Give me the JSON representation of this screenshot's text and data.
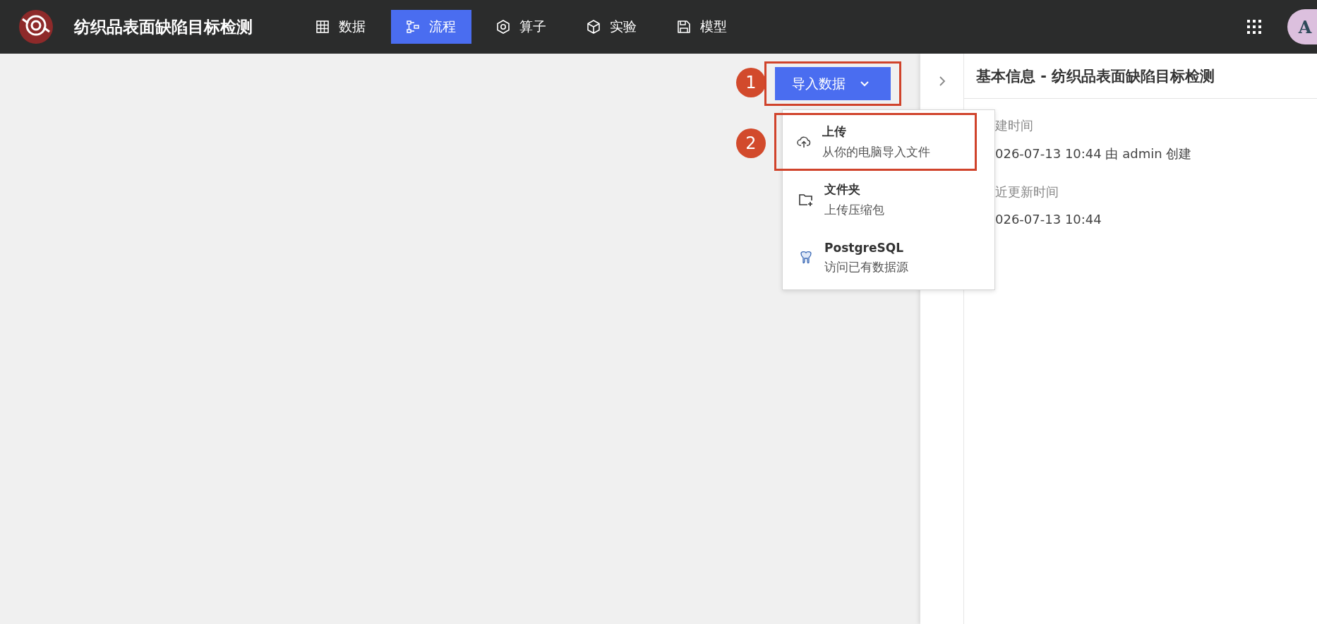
{
  "app": {
    "title": "纺织品表面缺陷目标检测"
  },
  "nav": [
    {
      "label": "数据",
      "kind": "table",
      "selected": false
    },
    {
      "label": "流程",
      "kind": "flow",
      "selected": true
    },
    {
      "label": "算子",
      "kind": "hexagon",
      "selected": false
    },
    {
      "label": "实验",
      "kind": "cube",
      "selected": false
    },
    {
      "label": "模型",
      "kind": "floppy",
      "selected": false
    }
  ],
  "user": {
    "initial": "A"
  },
  "import_button": {
    "label": "导入数据",
    "annotation": "1"
  },
  "dropdown": {
    "items": [
      {
        "title": "上传",
        "subtitle": "从你的电脑导入文件",
        "kind": "upload",
        "annotation": "2"
      },
      {
        "title": "文件夹",
        "subtitle": "上传压缩包",
        "kind": "folder"
      },
      {
        "title": "PostgreSQL",
        "subtitle": "访问已有数据源",
        "kind": "database"
      }
    ]
  },
  "panel": {
    "title": "基本信息 - 纺织品表面缺陷目标检测",
    "fields": [
      {
        "label": "建时间",
        "value": "026-07-13 10:44  由 admin 创建"
      },
      {
        "label": "近更新时间",
        "value": "026-07-13 10:44"
      }
    ]
  }
}
